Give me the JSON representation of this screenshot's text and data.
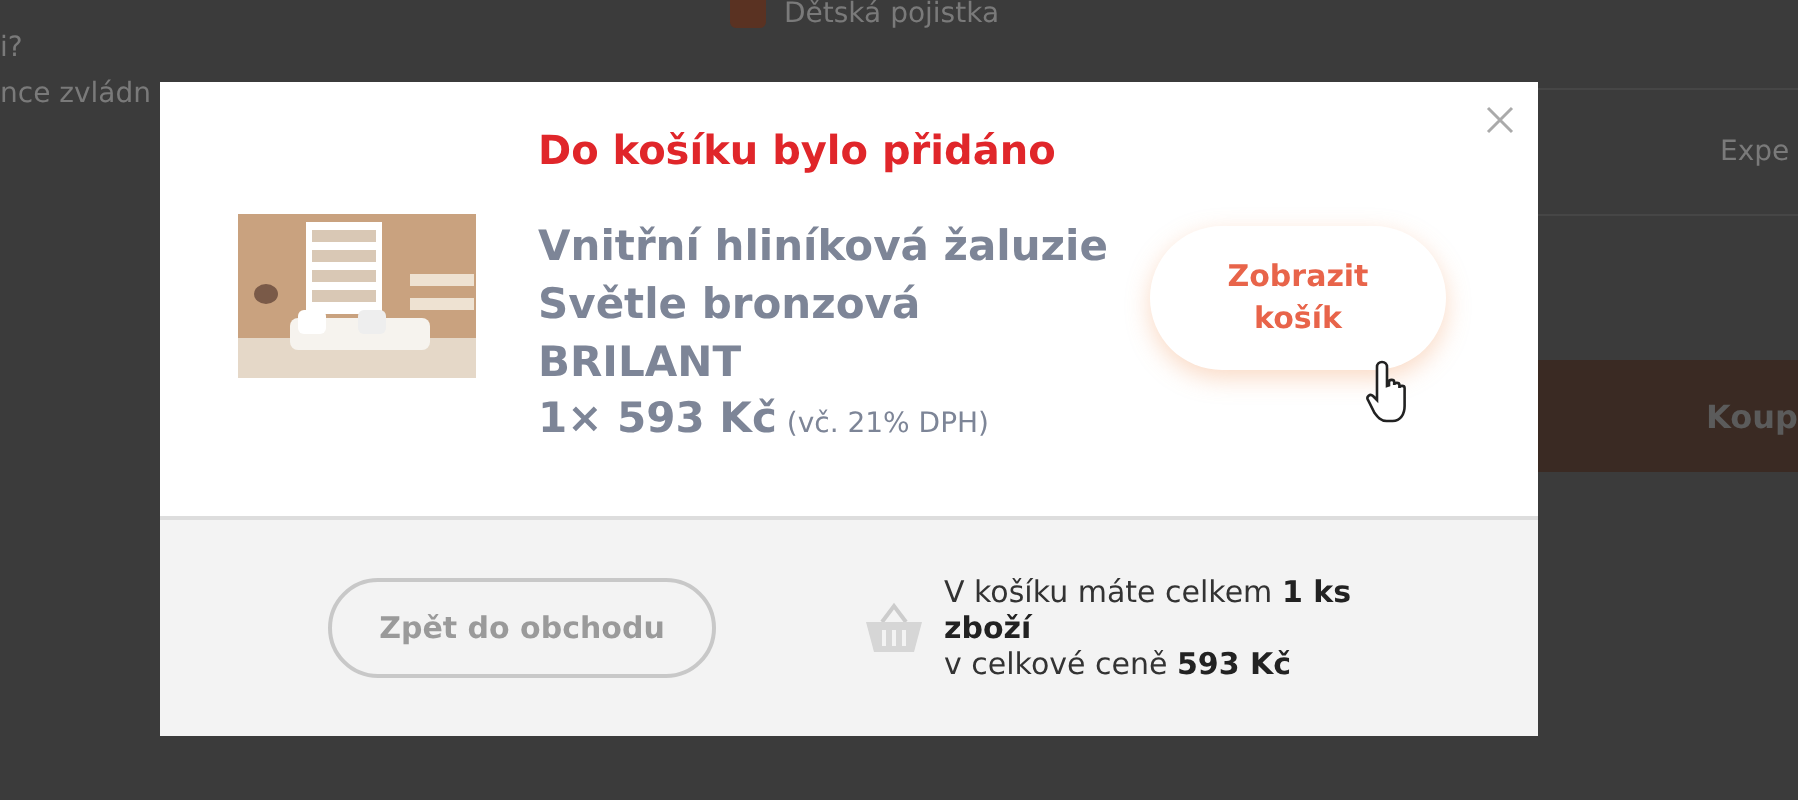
{
  "background_page": {
    "insurance_label": "Dětská pojistka",
    "insurance_checked": true,
    "question_fragment": "i?",
    "text_fragment": "nce zvládn",
    "column_fragment": "Expe",
    "buy_button": "Koup"
  },
  "modal": {
    "title": "Do košíku bylo přidáno",
    "product": {
      "name": "Vnitřní hliníková žaluzie Světle bronzová BRILANT",
      "quantity_price": "1× 593 Kč",
      "vat_note": "(vč. 21% DPH)"
    },
    "view_cart_button": "Zobrazit košík",
    "back_button": "Zpět do obchodu",
    "cart_summary": "V košíku máte celkem **1 ks zboží**\nv celkové ceně **593 Kč**"
  }
}
